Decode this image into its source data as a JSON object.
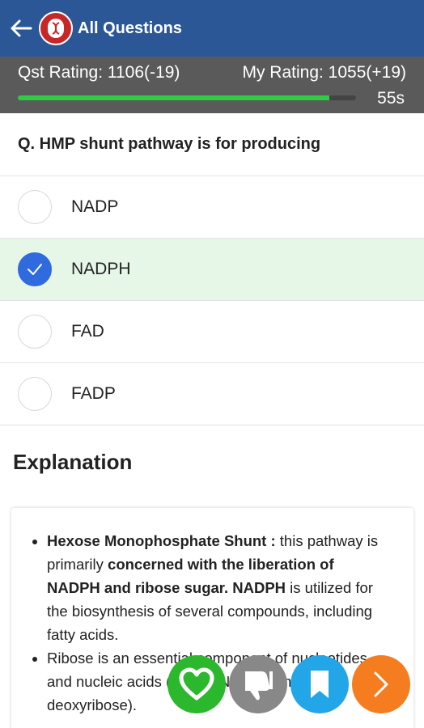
{
  "appbar": {
    "title": "All Questions",
    "back_icon": "arrow-left-icon",
    "logo_icon": "app-logo-icon",
    "bg_color": "#2b5797"
  },
  "rating": {
    "qst_rating": "Qst Rating: 1106(-19)",
    "my_rating": "My Rating: 1055(+19)",
    "timer": "55s",
    "progress_fraction": 0.92,
    "progress_color": "#2ecc40"
  },
  "question": {
    "text": "Q. HMP shunt pathway is for producing"
  },
  "options": [
    {
      "label": "NADP",
      "selected": false
    },
    {
      "label": "NADPH",
      "selected": true
    },
    {
      "label": "FAD",
      "selected": false
    },
    {
      "label": "FADP",
      "selected": false
    }
  ],
  "explanation": {
    "heading": "Explanation",
    "b1_bold1": "Hexose Monophosphate Shunt :",
    "b1_text1": " this pathway is primarily ",
    "b1_bold2": "concerned with the liberation of NADPH and ribose sugar. NADPH",
    "b1_text2": " is utilized for the biosynthesis of several compounds, including fatty acids.",
    "b2_text": "Ribose is an essential component of nucleotides and nucleic acids (note: DNA contains deoxyribose)."
  },
  "fabs": {
    "like_icon": "heart-icon",
    "dislike_icon": "thumbs-down-icon",
    "bookmark_icon": "bookmark-icon",
    "next_icon": "chevron-right-icon",
    "like_color": "#2cb82c",
    "dislike_color": "#888888",
    "bookmark_color": "#22a6e8",
    "next_color": "#f57c1f"
  }
}
